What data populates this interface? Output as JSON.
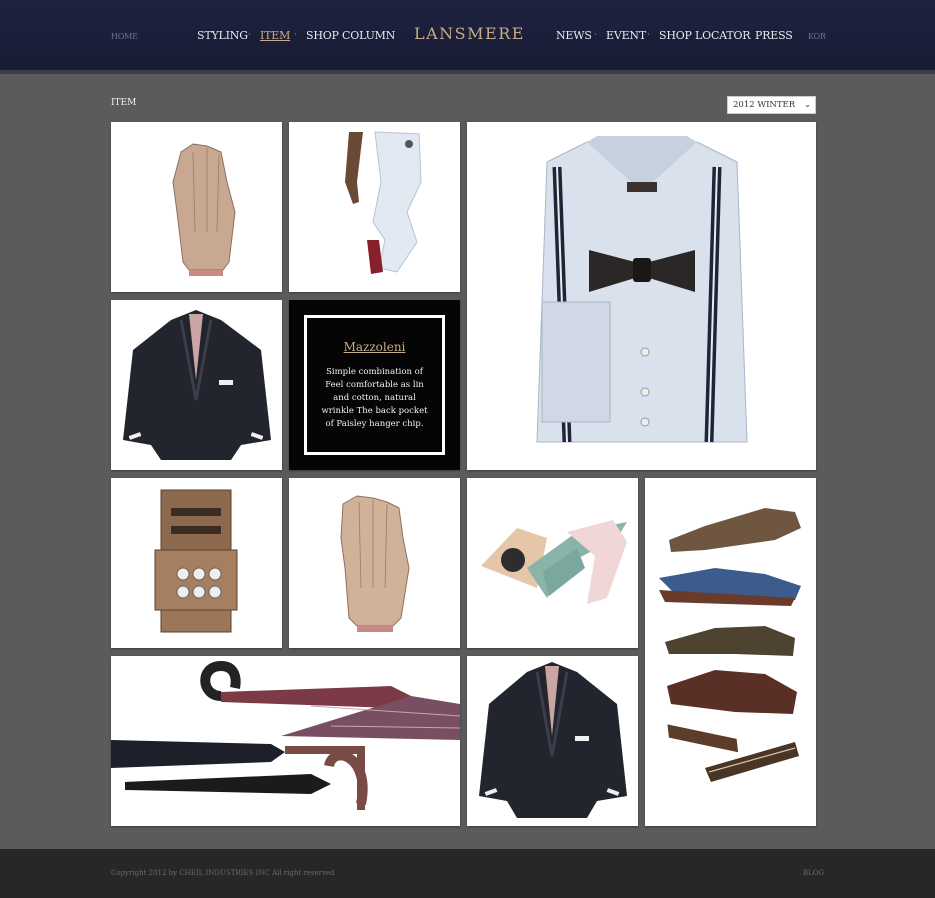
{
  "header": {
    "logo": "LANSMERE",
    "nav_left": {
      "home": "HOME",
      "styling": "STYLING",
      "item": "ITEM",
      "shop_column": "SHOP COLUMN"
    },
    "nav_right": {
      "news": "NEWS",
      "event": "EVENT",
      "shop_locator": "SHOP LOCATOR",
      "press": "PRESS",
      "kor": "KOR"
    },
    "separator": "·",
    "active_item": "ITEM"
  },
  "main": {
    "section_title": "ITEM",
    "season_select": {
      "selected": "2012 WINTER"
    },
    "feature": {
      "title": "Mazzoleni",
      "description": "Simple combination of Feel comfortable as lin and cotton, natural wrinkle The back pocket of Paisley hanger chip."
    },
    "products": [
      {
        "icon": "gloves-icon"
      },
      {
        "icon": "trousers-belt-icon"
      },
      {
        "icon": "shirt-bowtie-icon"
      },
      {
        "icon": "jacket-icon"
      },
      {
        "icon": "shoe-care-kit-icon"
      },
      {
        "icon": "gloves-icon"
      },
      {
        "icon": "ties-icon"
      },
      {
        "icon": "shoes-icon"
      },
      {
        "icon": "umbrella-shoehorn-icon"
      },
      {
        "icon": "jacket-icon"
      }
    ]
  },
  "footer": {
    "copyright": "Copyright 2012 by CHEIL INDUSTRIES INC All right reserved",
    "blog": "BLOG"
  },
  "colors": {
    "header_bg": "#1b203a",
    "accent": "#c9ab8c",
    "page_bg": "#5b5b5b",
    "footer_bg": "#272727"
  }
}
